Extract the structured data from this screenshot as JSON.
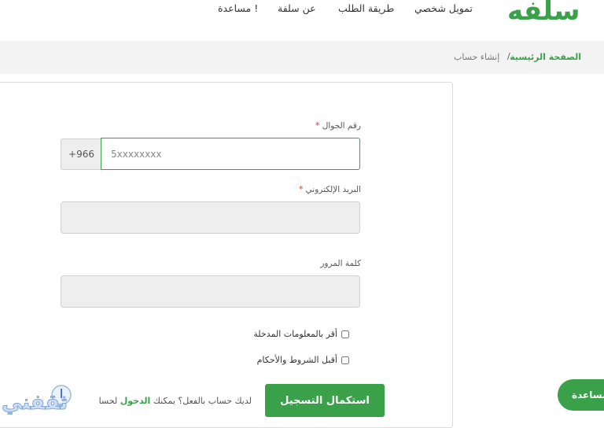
{
  "brand": {
    "logo_text": "سلفه",
    "accent": "#3aa14a"
  },
  "nav": {
    "items": [
      "تمويل شخصي",
      "طريقة الطلب",
      "عن سلفة",
      "مساعدة !"
    ]
  },
  "breadcrumb": {
    "home": "الصفحة الرئيسية",
    "separator": "/",
    "current": "إنشاء حساب"
  },
  "form": {
    "phone": {
      "label": "رقم الجوال",
      "required_mark": "*",
      "prefix": "+966",
      "placeholder": "5xxxxxxxx"
    },
    "email": {
      "label": "البريد الإلكتروني",
      "required_mark": "*",
      "value": ""
    },
    "password": {
      "label": "كلمة المرور",
      "value": ""
    },
    "check_info": "أقر بالمعلومات المدخلة",
    "check_terms": "أقبل الشروط والأحكام",
    "submit_label": "استكمال التسجيل",
    "login_prompt": "لديك حساب بالفعل؟ يمكنك",
    "login_link": "الدخول",
    "login_suffix": "لحسا"
  },
  "help": {
    "label": "مساعدة"
  },
  "watermark": {
    "text": "ثقفني",
    "icon": "lightbulb-icon"
  }
}
